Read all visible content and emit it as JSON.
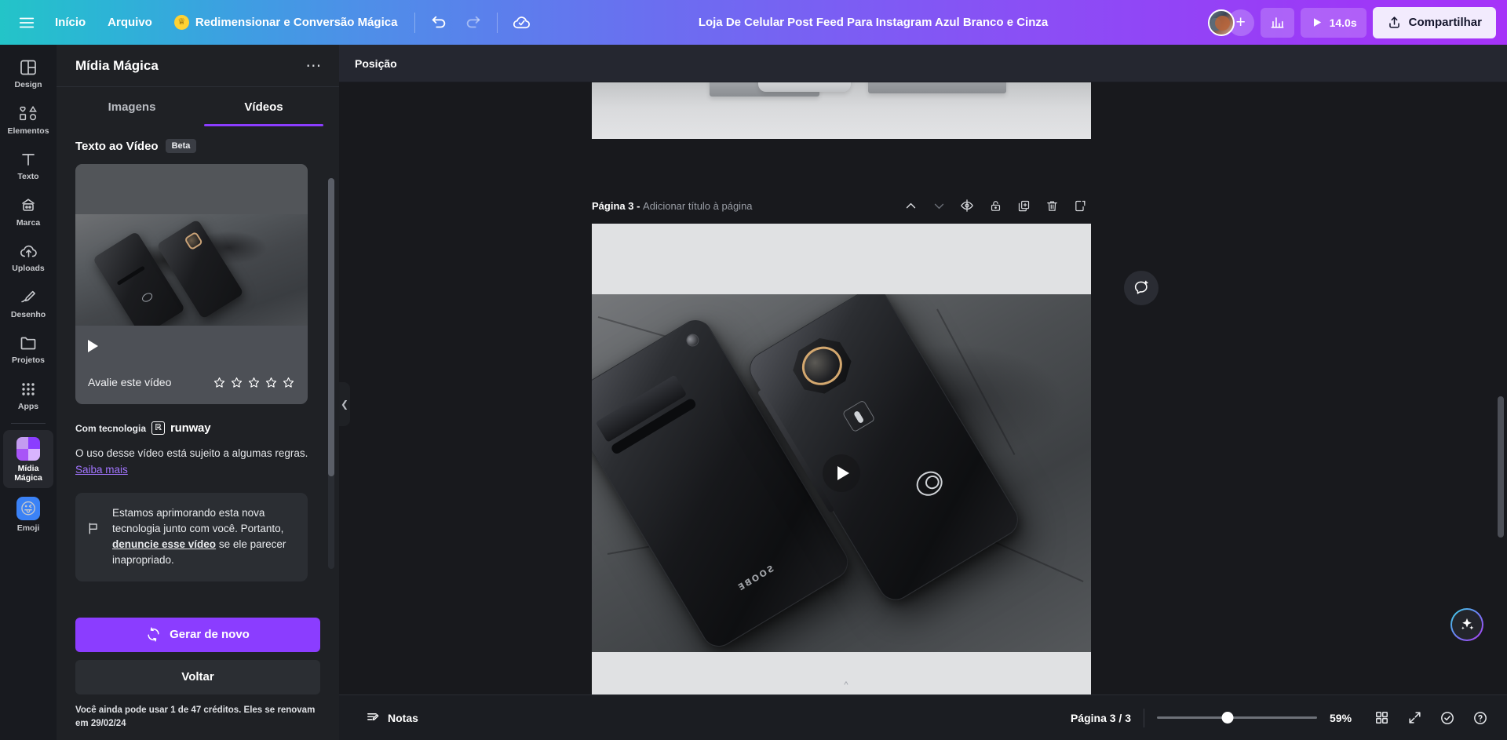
{
  "topbar": {
    "menu_icon": "hamburger-menu-icon",
    "home_label": "Início",
    "file_label": "Arquivo",
    "magic_resize_label": "Redimensionar e Conversão Mágica",
    "crown_icon": "crown-icon",
    "undo_icon": "undo-icon",
    "redo_icon": "redo-icon",
    "cloud_saved_icon": "cloud-check-icon",
    "doc_title": "Loja De Celular Post Feed Para Instagram Azul Branco e Cinza",
    "avatar_icon": "user-avatar",
    "add_people_label": "+",
    "analytics_icon": "bar-chart-icon",
    "play_icon": "play-icon",
    "duration_label": "14.0s",
    "share_icon": "share-upload-icon",
    "share_label": "Compartilhar"
  },
  "rail": {
    "items": [
      {
        "label": "Design",
        "icon": "layout-design-icon",
        "active": false
      },
      {
        "label": "Elementos",
        "icon": "shapes-icon",
        "active": false
      },
      {
        "label": "Texto",
        "icon": "text-t-icon",
        "active": false
      },
      {
        "label": "Marca",
        "icon": "brand-kit-icon",
        "active": false
      },
      {
        "label": "Uploads",
        "icon": "cloud-upload-icon",
        "active": false
      },
      {
        "label": "Desenho",
        "icon": "pen-draw-icon",
        "active": false
      },
      {
        "label": "Projetos",
        "icon": "folder-icon",
        "active": false
      },
      {
        "label": "Apps",
        "icon": "grid-apps-icon",
        "active": false
      }
    ],
    "pinned": [
      {
        "label": "Mídia Mágica",
        "icon": "magic-media-tile-icon",
        "active": true
      },
      {
        "label": "Emoji",
        "icon": "emoji-tile-icon",
        "active": false
      }
    ]
  },
  "panel": {
    "title": "Mídia Mágica",
    "more_icon": "more-options-icon",
    "tabs": [
      {
        "label": "Imagens",
        "active": false
      },
      {
        "label": "Vídeos",
        "active": true
      }
    ],
    "section": {
      "title": "Texto ao Vídeo",
      "badge": "Beta"
    },
    "video_card": {
      "play_icon": "play-icon",
      "rate_label": "Avalie este vídeo",
      "stars": 5,
      "stars_filled": 0,
      "star_icon": "star-outline-icon"
    },
    "powered_by": {
      "label": "Com tecnologia",
      "mark_icon": "runway-logo-icon",
      "brand": "runway"
    },
    "rules_text": "O uso desse vídeo está sujeito a algumas regras.",
    "rules_link": "Saiba mais",
    "notice": {
      "icon": "flag-icon",
      "text_before": "Estamos aprimorando esta nova tecnologia junto com você. Portanto, ",
      "text_link": "denuncie esse vídeo",
      "text_after": " se ele parecer inapropriado."
    },
    "regenerate": {
      "icon": "refresh-icon",
      "label": "Gerar de novo"
    },
    "back_label": "Voltar",
    "credits_text": "Você ainda pode usar 1 de 47 créditos. Eles se renovam em 29/02/24",
    "collapse_icon": "chevron-left-icon"
  },
  "editor": {
    "context_toolbar": {
      "position_label": "Posição"
    },
    "page": {
      "name": "Página 3 -",
      "title_placeholder": "Adicionar título à página",
      "actions": [
        {
          "icon": "chevron-up-icon",
          "name": "move-page-up",
          "dim": false
        },
        {
          "icon": "chevron-down-icon",
          "name": "move-page-down",
          "dim": true
        },
        {
          "icon": "hide-page-icon",
          "name": "hide-page",
          "dim": false
        },
        {
          "icon": "lock-icon",
          "name": "lock-page",
          "dim": false
        },
        {
          "icon": "duplicate-icon",
          "name": "duplicate-page",
          "dim": false
        },
        {
          "icon": "trash-icon",
          "name": "delete-page",
          "dim": false
        },
        {
          "icon": "add-page-icon",
          "name": "add-page",
          "dim": false
        }
      ]
    },
    "canvas_play_icon": "play-overlay-icon",
    "comment_fab_icon": "add-comment-icon",
    "magic_fab_icon": "magic-sparkle-icon",
    "scroll_hint_icon": "chevron-up-icon"
  },
  "bottombar": {
    "notes_icon": "notes-icon",
    "notes_label": "Notas",
    "page_count_label": "Página 3 / 3",
    "zoom_value": "59%",
    "zoom_percent": 59,
    "grid_view_icon": "grid-view-icon",
    "fullscreen_icon": "expand-fullscreen-icon",
    "help_check_icon": "check-circle-icon",
    "help_icon": "question-circle-icon"
  },
  "colors": {
    "brand_purple": "#8b3dff",
    "panel_bg": "#1f2125",
    "rail_bg": "#181a1f",
    "editor_bg": "#18191d",
    "accent_link": "#a275ff",
    "share_bg": "#f2ebfd"
  }
}
